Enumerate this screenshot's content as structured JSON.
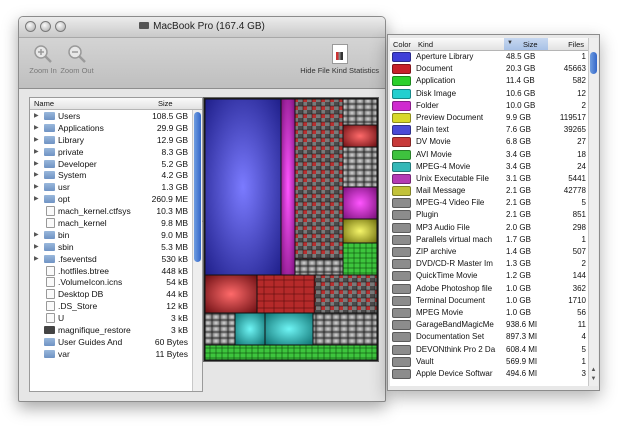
{
  "main_window": {
    "title": "MacBook Pro (167.4 GB)",
    "toolbar": {
      "zoom_in": "Zoom In",
      "zoom_out": "Zoom Out",
      "hide_stats": "Hide File Kind Statistics"
    }
  },
  "file_tree": {
    "columns": {
      "name": "Name",
      "size": "Size"
    },
    "rows": [
      {
        "name": "Users",
        "size": "108.5 GB",
        "icon": "folder-icon",
        "expandable": true
      },
      {
        "name": "Applications",
        "size": "29.9 GB",
        "icon": "folder-icon",
        "expandable": true
      },
      {
        "name": "Library",
        "size": "12.9 GB",
        "icon": "folder-icon",
        "expandable": true
      },
      {
        "name": "private",
        "size": "8.3 GB",
        "icon": "folder-icon",
        "expandable": true
      },
      {
        "name": "Developer",
        "size": "5.2 GB",
        "icon": "folder-icon",
        "expandable": true
      },
      {
        "name": "System",
        "size": "4.2 GB",
        "icon": "folder-icon",
        "expandable": true
      },
      {
        "name": "usr",
        "size": "1.3 GB",
        "icon": "folder-icon",
        "expandable": true
      },
      {
        "name": "opt",
        "size": "260.9 ME",
        "icon": "folder-icon",
        "expandable": true
      },
      {
        "name": "mach_kernel.ctfsys",
        "size": "10.3 MB",
        "icon": "file-icon",
        "expandable": false
      },
      {
        "name": "mach_kernel",
        "size": "9.8 MB",
        "icon": "file-icon",
        "expandable": false
      },
      {
        "name": "bin",
        "size": "9.0 MB",
        "icon": "folder-icon",
        "expandable": true
      },
      {
        "name": "sbin",
        "size": "5.3 MB",
        "icon": "folder-icon",
        "expandable": true
      },
      {
        "name": ".fseventsd",
        "size": "530 kB",
        "icon": "folder-icon",
        "expandable": true
      },
      {
        "name": ".hotfiles.btree",
        "size": "448 kB",
        "icon": "file-icon",
        "expandable": false
      },
      {
        "name": ".VolumeIcon.icns",
        "size": "54 kB",
        "icon": "file-icon",
        "expandable": false
      },
      {
        "name": "Desktop DB",
        "size": "44 kB",
        "icon": "file-icon",
        "expandable": false
      },
      {
        "name": ".DS_Store",
        "size": "12 kB",
        "icon": "file-icon",
        "expandable": false
      },
      {
        "name": "U",
        "size": "3 kB",
        "icon": "file-icon",
        "expandable": false
      },
      {
        "name": "magnifique_restore",
        "size": "3 kB",
        "icon": "drive-icon",
        "expandable": false
      },
      {
        "name": "User Guides And",
        "size": "60 Bytes",
        "icon": "folder-icon",
        "expandable": false
      },
      {
        "name": "var",
        "size": "11 Bytes",
        "icon": "folder-icon",
        "expandable": false
      }
    ]
  },
  "kinds_table": {
    "columns": {
      "color": "Color",
      "kind": "Kind",
      "size": "Size",
      "files": "Files"
    },
    "rows": [
      {
        "color": "#3f3fd8",
        "kind": "Aperture Library",
        "size": "48.5 GB",
        "files": "1"
      },
      {
        "color": "#c6202a",
        "kind": "Document",
        "size": "20.3 GB",
        "files": "45663"
      },
      {
        "color": "#2bd02b",
        "kind": "Application",
        "size": "11.4 GB",
        "files": "582"
      },
      {
        "color": "#22cfcf",
        "kind": "Disk Image",
        "size": "10.6 GB",
        "files": "12"
      },
      {
        "color": "#cf2bcf",
        "kind": "Folder",
        "size": "10.0 GB",
        "files": "2"
      },
      {
        "color": "#d8d82a",
        "kind": "Preview Document",
        "size": "9.9 GB",
        "files": "119517"
      },
      {
        "color": "#4a4ad6",
        "kind": "Plain text",
        "size": "7.6 GB",
        "files": "39265"
      },
      {
        "color": "#c83a3a",
        "kind": "DV Movie",
        "size": "6.8 GB",
        "files": "27"
      },
      {
        "color": "#3ec23e",
        "kind": "AVI Movie",
        "size": "3.4 GB",
        "files": "18"
      },
      {
        "color": "#34b8b8",
        "kind": "MPEG-4 Movie",
        "size": "3.4 GB",
        "files": "24"
      },
      {
        "color": "#b43ab4",
        "kind": "Unix Executable File",
        "size": "3.1 GB",
        "files": "5441"
      },
      {
        "color": "#c2c23a",
        "kind": "Mail Message",
        "size": "2.1 GB",
        "files": "42778"
      },
      {
        "color": "#8c8c8c",
        "kind": "MPEG-4 Video File",
        "size": "2.1 GB",
        "files": "5"
      },
      {
        "color": "#8c8c8c",
        "kind": "Plugin",
        "size": "2.1 GB",
        "files": "851"
      },
      {
        "color": "#8c8c8c",
        "kind": "MP3 Audio File",
        "size": "2.0 GB",
        "files": "298"
      },
      {
        "color": "#8c8c8c",
        "kind": "Parallels virtual mach",
        "size": "1.7 GB",
        "files": "1"
      },
      {
        "color": "#8c8c8c",
        "kind": "ZIP archive",
        "size": "1.4 GB",
        "files": "507"
      },
      {
        "color": "#8c8c8c",
        "kind": "DVD/CD-R Master Im",
        "size": "1.3 GB",
        "files": "2"
      },
      {
        "color": "#8c8c8c",
        "kind": "QuickTime Movie",
        "size": "1.2 GB",
        "files": "144"
      },
      {
        "color": "#8c8c8c",
        "kind": "Adobe Photoshop file",
        "size": "1.0 GB",
        "files": "362"
      },
      {
        "color": "#8c8c8c",
        "kind": "Terminal Document",
        "size": "1.0 GB",
        "files": "1710"
      },
      {
        "color": "#8c8c8c",
        "kind": "MPEG Movie",
        "size": "1.0 GB",
        "files": "56"
      },
      {
        "color": "#8c8c8c",
        "kind": "GarageBandMagicMe",
        "size": "938.6 MI",
        "files": "11"
      },
      {
        "color": "#8c8c8c",
        "kind": "Documentation Set",
        "size": "897.3 MI",
        "files": "4"
      },
      {
        "color": "#8c8c8c",
        "kind": "DEVONthink Pro 2 Da",
        "size": "608.4 MI",
        "files": "5"
      },
      {
        "color": "#8c8c8c",
        "kind": "Vault",
        "size": "569.9 MI",
        "files": "1"
      },
      {
        "color": "#8c8c8c",
        "kind": "Apple Device Softwar",
        "size": "494.6 MI",
        "files": "3"
      }
    ]
  }
}
